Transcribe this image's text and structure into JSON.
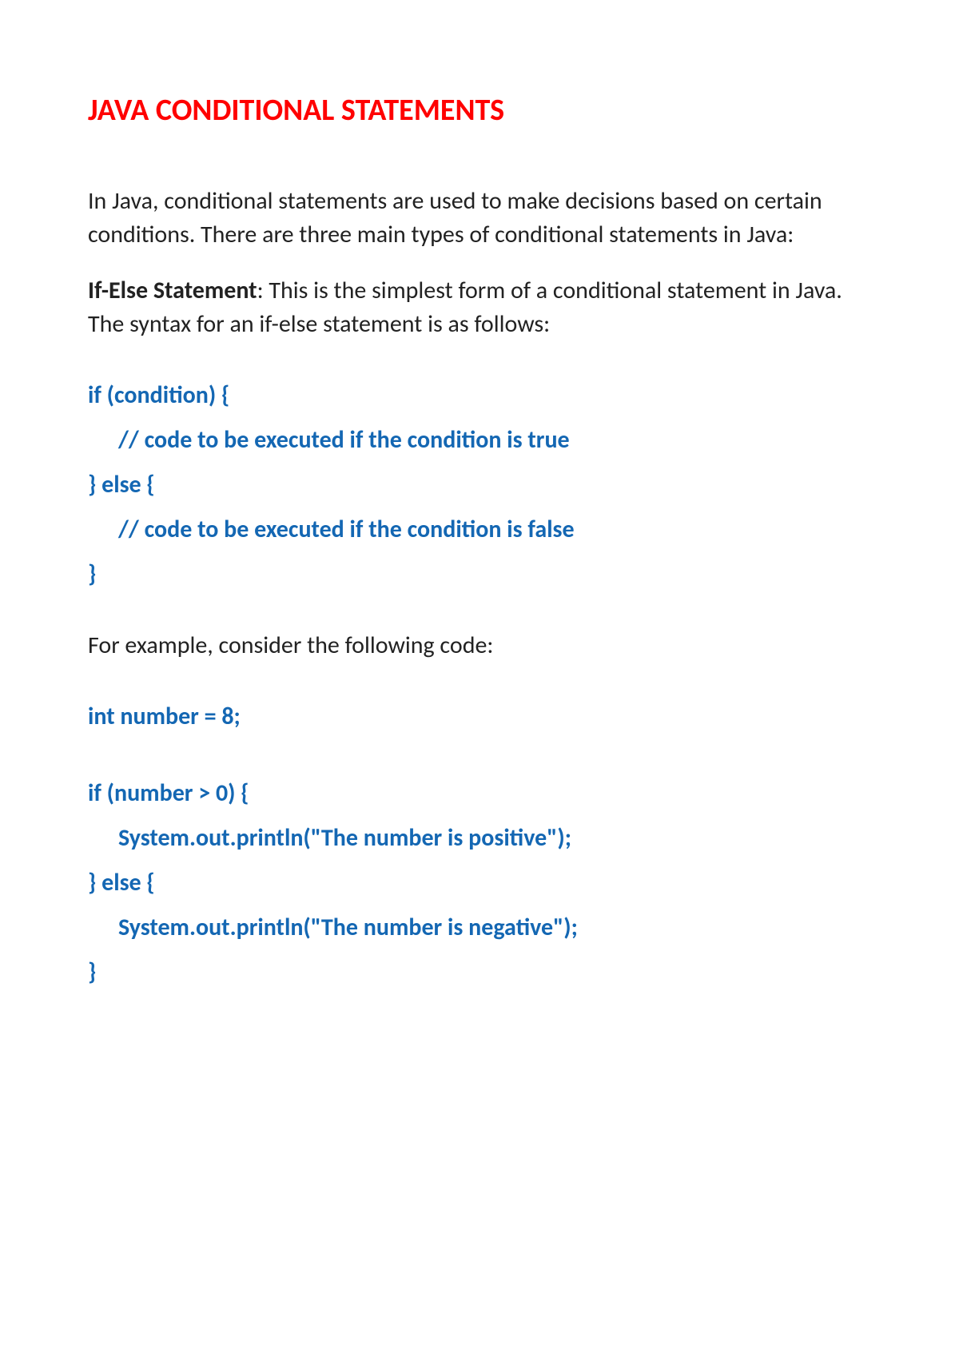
{
  "title": "JAVA CONDITIONAL STATEMENTS",
  "intro": "In Java, conditional statements are used to make decisions based on certain conditions. There are three main types of conditional statements in Java:",
  "ifelse": {
    "label": "If-Else Statement",
    "desc": ": This is the simplest form of a conditional statement in Java. The syntax for an if-else statement is as follows:"
  },
  "syntax": {
    "l1": "if (condition) {",
    "l2": "// code to be executed if the condition is true",
    "l3": "} else {",
    "l4": "// code to be executed if the condition is false",
    "l5": "}"
  },
  "transition": "For example, consider the following code:",
  "example": {
    "l1": "int number = 8;",
    "l2": "if (number > 0) {",
    "l3": "System.out.println(\"The number is positive\");",
    "l4": "} else {",
    "l5": "System.out.println(\"The number is negative\");",
    "l6": "}"
  }
}
